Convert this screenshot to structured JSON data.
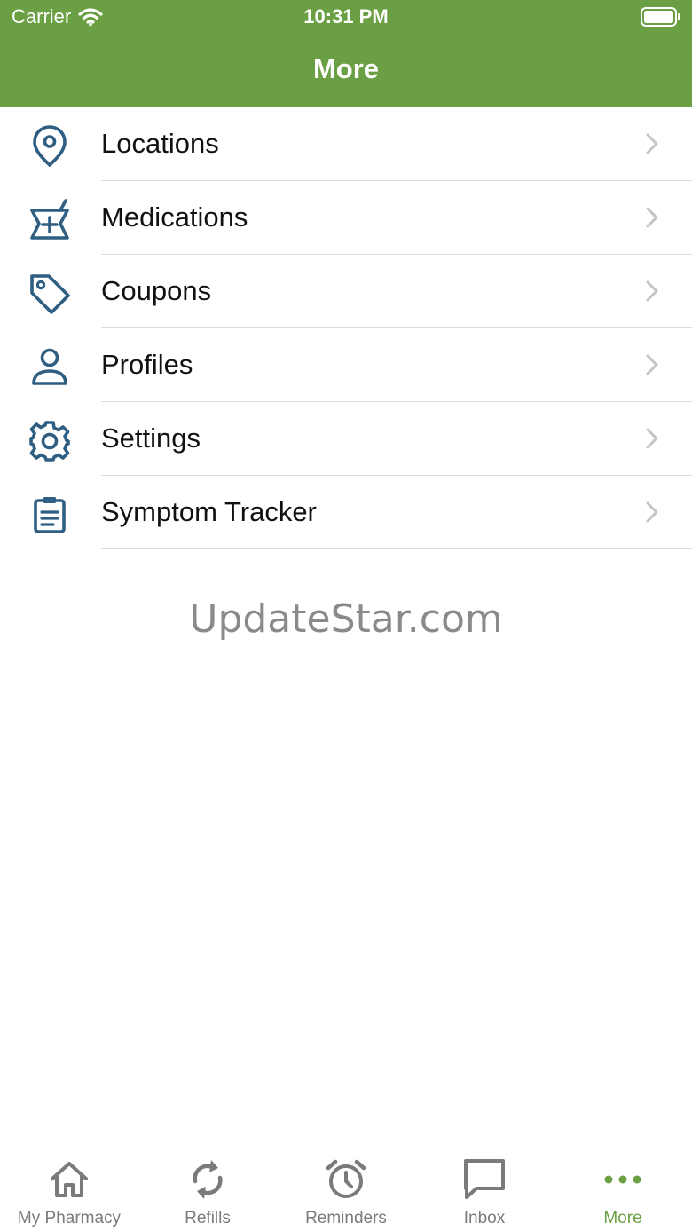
{
  "status_bar": {
    "carrier": "Carrier",
    "time": "10:31 PM"
  },
  "header": {
    "title": "More",
    "background_color": "#6aa043"
  },
  "menu": {
    "icon_color": "#2e5e82",
    "items": [
      {
        "label": "Locations",
        "icon": "location-pin-icon"
      },
      {
        "label": "Medications",
        "icon": "mortar-pestle-icon"
      },
      {
        "label": "Coupons",
        "icon": "tag-icon"
      },
      {
        "label": "Profiles",
        "icon": "user-icon"
      },
      {
        "label": "Settings",
        "icon": "gear-icon"
      },
      {
        "label": "Symptom Tracker",
        "icon": "clipboard-icon"
      }
    ]
  },
  "watermark": "UpdateStar.com",
  "tab_bar": {
    "active_color": "#6aa043",
    "inactive_color": "#7a7a7a",
    "tabs": [
      {
        "label": "My Pharmacy",
        "icon": "home-icon",
        "active": false
      },
      {
        "label": "Refills",
        "icon": "refresh-icon",
        "active": false
      },
      {
        "label": "Reminders",
        "icon": "alarm-clock-icon",
        "active": false
      },
      {
        "label": "Inbox",
        "icon": "chat-bubble-icon",
        "active": false
      },
      {
        "label": "More",
        "icon": "more-dots-icon",
        "active": true
      }
    ]
  }
}
